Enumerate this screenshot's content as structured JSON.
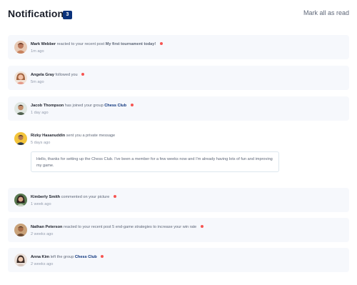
{
  "header": {
    "title": "Notifications",
    "unread_count": "3",
    "mark_all": "Mark all as read"
  },
  "notifications": [
    {
      "name": "Mark Webber",
      "action": "reacted to your recent post",
      "target": "My first tournament today!",
      "target_type": "post",
      "time": "1m ago",
      "unread": true
    },
    {
      "name": "Angela Gray",
      "action": "followed you",
      "target": "",
      "target_type": "",
      "time": "5m ago",
      "unread": true
    },
    {
      "name": "Jacob Thompson",
      "action": "has joined your group",
      "target": "Chess Club",
      "target_type": "group",
      "time": "1 day ago",
      "unread": true
    },
    {
      "name": "Rizky Hasanuddin",
      "action": "sent you a private message",
      "target": "",
      "target_type": "",
      "time": "5 days ago",
      "unread": false,
      "message": "Hello, thanks for setting up the Chess Club. I've been a member for a few weeks now and I'm already having lots of fun and improving my game."
    },
    {
      "name": "Kimberly Smith",
      "action": "commented on your picture",
      "target": "",
      "target_type": "",
      "time": "1 week ago",
      "unread": true
    },
    {
      "name": "Nathan Peterson",
      "action": "reacted to your recent post",
      "target": "5 end-game strategies to increase your win rate",
      "target_type": "post-plain",
      "time": "2 weeks ago",
      "unread": true
    },
    {
      "name": "Anna Kim",
      "action": "left the group",
      "target": "Chess Club",
      "target_type": "group",
      "time": "2 weeks ago",
      "unread": true
    }
  ],
  "colors": {
    "unread_bg": "#f6f8fc",
    "dot": "#f65552",
    "badge": "#0a327b",
    "name": "#1c202b",
    "group_link": "#0a327b"
  }
}
